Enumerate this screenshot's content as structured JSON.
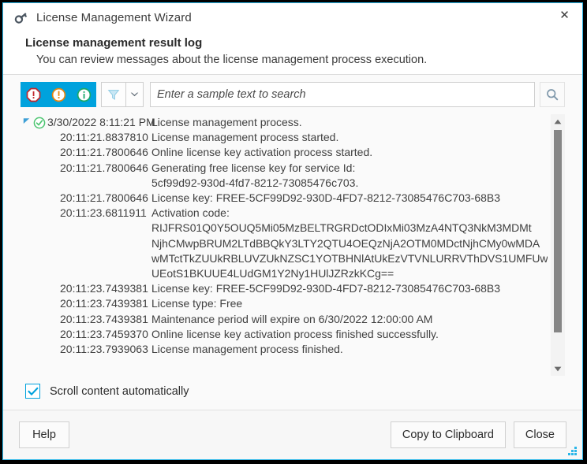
{
  "window": {
    "title": "License Management Wizard",
    "title_icon": "key-icon",
    "close_label": "✕"
  },
  "header": {
    "title": "License management result log",
    "subtitle": "You can review messages about the license management process execution."
  },
  "toolbar": {
    "buttons": [
      {
        "name": "filter-errors-button",
        "icon": "error-octagon-icon",
        "active": true
      },
      {
        "name": "filter-warnings-button",
        "icon": "warning-circle-icon",
        "active": true
      },
      {
        "name": "filter-info-button",
        "icon": "info-circle-icon",
        "active": true
      },
      {
        "name": "filter-button",
        "icon": "funnel-icon",
        "active": false
      },
      {
        "name": "filter-dropdown-button",
        "icon": "chevron-down-icon",
        "active": false
      }
    ],
    "search_placeholder": "Enter a sample text to search",
    "search_value": "",
    "search_go_icon": "search-icon"
  },
  "log": {
    "rows": [
      {
        "kind": "root",
        "status_icon": "success-check-icon",
        "expander": "collapse-triangle-icon",
        "time": "3/30/2022 8:11:21 PM",
        "message": "License management process."
      },
      {
        "kind": "child",
        "time": "20:11:21.8837810",
        "message": "License management process started."
      },
      {
        "kind": "child",
        "time": "20:11:21.7800646",
        "message": "Online license key activation process started."
      },
      {
        "kind": "child",
        "time": "20:11:21.7800646",
        "message": "Generating free license key for service Id:"
      },
      {
        "kind": "continuation",
        "time": "",
        "message": "5cf99d92-930d-4fd7-8212-73085476c703."
      },
      {
        "kind": "child",
        "time": "20:11:21.7800646",
        "message": "License key: FREE-5CF99D92-930D-4FD7-8212-73085476C703-68B3"
      },
      {
        "kind": "child",
        "time": "20:11:23.6811911",
        "message": "Activation code:"
      },
      {
        "kind": "continuation",
        "code": true,
        "time": "",
        "message": "RIJFRS01Q0Y5OUQ5Mi05MzBELTRGRDctODIxMi03MzA4NTQ3NkM3MDMt"
      },
      {
        "kind": "continuation",
        "code": true,
        "time": "",
        "message": "NjhCMwpBRUM2LTdBBQkY3LTY2QTU4OEQzNjA2OTM0MDctNjhCMy0wMDA"
      },
      {
        "kind": "continuation",
        "code": true,
        "time": "",
        "message": "wMTctTkZUUkRBLUVZUkNZSC1YOTBHNlAtUkEzVTVNLURRVThDVS1UMFUw"
      },
      {
        "kind": "continuation",
        "code": true,
        "time": "",
        "message": "UEotS1BKUUE4LUdGM1Y2Ny1HUlJZRzkKCg=="
      },
      {
        "kind": "child",
        "time": "20:11:23.7439381",
        "message": "License key: FREE-5CF99D92-930D-4FD7-8212-73085476C703-68B3"
      },
      {
        "kind": "child",
        "time": "20:11:23.7439381",
        "message": "License type: Free"
      },
      {
        "kind": "child",
        "time": "20:11:23.7439381",
        "message": "Maintenance period will expire on 6/30/2022 12:00:00 AM"
      },
      {
        "kind": "child",
        "time": "20:11:23.7459370",
        "message": "Online license key activation process finished successfully."
      },
      {
        "kind": "child",
        "time": "20:11:23.7939063",
        "message": "License management process finished."
      }
    ],
    "scroll_up_icon": "scroll-up-arrow-icon",
    "scroll_down_icon": "scroll-down-arrow-icon"
  },
  "options": {
    "scroll_auto_label": "Scroll content automatically",
    "scroll_auto_checked": true
  },
  "footer": {
    "help_label": "Help",
    "copy_label": "Copy to Clipboard",
    "close_label": "Close"
  },
  "colors": {
    "accent": "#00a2dd",
    "window_border": "#29b6e8",
    "error": "#c1272d",
    "warning": "#e8840c",
    "info": "#1aa86a",
    "success": "#4bc46f",
    "scrollbar_thumb": "#868686"
  }
}
